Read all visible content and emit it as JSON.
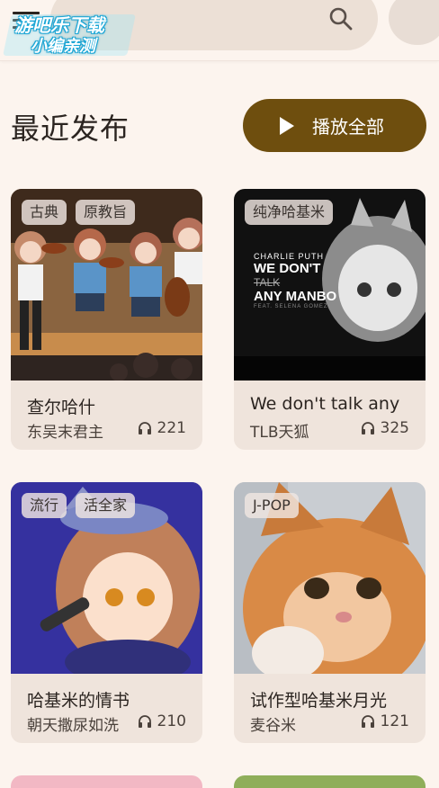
{
  "topbar": {
    "watermark_line1": "游吧乐下载",
    "watermark_line2": "小编亲测"
  },
  "header": {
    "title": "最近发布",
    "play_all_label": "播放全部"
  },
  "cards": [
    {
      "tags": [
        "古典",
        "原教旨"
      ],
      "title": "查尔哈什",
      "artist": "东吴末君主",
      "plays": "221"
    },
    {
      "tags": [
        "纯净哈基米"
      ],
      "title": "We don't talk any",
      "artist": "TLB天狐",
      "plays": "325",
      "art_text": {
        "line1": "CHARLIE PUTH",
        "line2": "WE DON'T",
        "line3": "TALK",
        "line4": "ANY MANBO",
        "line5": "FEAT. SELENA GOMEZ"
      }
    },
    {
      "tags": [
        "流行",
        "活全家"
      ],
      "title": "哈基米的情书",
      "artist": "朝天撒尿如洗",
      "plays": "210"
    },
    {
      "tags": [
        "J-POP"
      ],
      "title": "试作型哈基米月光",
      "artist": "麦谷米",
      "plays": "121"
    }
  ],
  "colors": {
    "background": "#fcf4ee",
    "accent": "#6e4e0e",
    "card": "#efe4dc"
  }
}
